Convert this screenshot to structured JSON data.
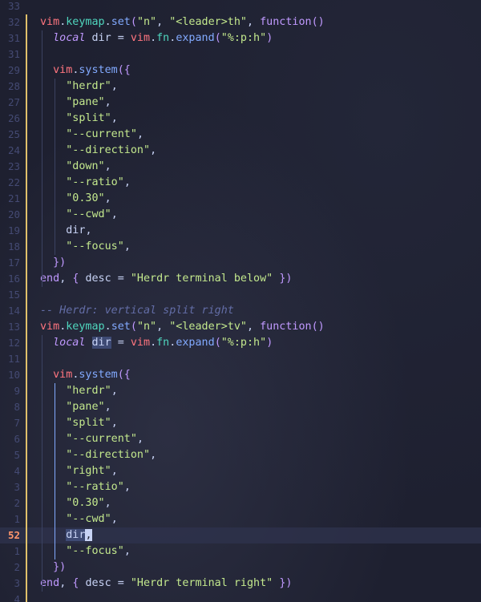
{
  "cursor_line_number": "52",
  "blocks": [
    {
      "numbers": {
        "header": "32",
        "local": "31",
        "blank": "31",
        "system": "29",
        "close_args": "17",
        "end": "16"
      },
      "keymap_mode": "\"n\"",
      "keymap_lhs": "\"<leader>th\"",
      "expand_arg": "\"%:p:h\"",
      "args": [
        "\"herdr\",",
        "\"pane\",",
        "\"split\",",
        "\"--current\",",
        "\"--direction\",",
        "\"down\",",
        "\"--ratio\",",
        "\"0.30\",",
        "\"--cwd\",",
        "dir,",
        "\"--focus\","
      ],
      "arg_numbers": [
        "28",
        "27",
        "26",
        "25",
        "24",
        "23",
        "22",
        "21",
        "20",
        "19",
        "18"
      ],
      "desc": "\"Herdr terminal below\""
    }
  ],
  "lines": [
    {
      "n": "33",
      "kind": "blank"
    },
    {
      "n": "32",
      "kind": "keymap",
      "mode": "\"n\"",
      "lhs": "\"<leader>th\""
    },
    {
      "n": "31",
      "kind": "local",
      "expand": "\"%:p:h\"",
      "hl": false
    },
    {
      "n": "31",
      "kind": "blank"
    },
    {
      "n": "29",
      "kind": "system"
    },
    {
      "n": "28",
      "kind": "arg",
      "text": "\"herdr\""
    },
    {
      "n": "27",
      "kind": "arg",
      "text": "\"pane\""
    },
    {
      "n": "26",
      "kind": "arg",
      "text": "\"split\""
    },
    {
      "n": "25",
      "kind": "arg",
      "text": "\"--current\""
    },
    {
      "n": "24",
      "kind": "arg",
      "text": "\"--direction\""
    },
    {
      "n": "23",
      "kind": "arg",
      "text": "\"down\""
    },
    {
      "n": "22",
      "kind": "arg",
      "text": "\"--ratio\""
    },
    {
      "n": "21",
      "kind": "arg",
      "text": "\"0.30\""
    },
    {
      "n": "20",
      "kind": "arg",
      "text": "\"--cwd\""
    },
    {
      "n": "19",
      "kind": "argid",
      "text": "dir"
    },
    {
      "n": "18",
      "kind": "arg",
      "text": "\"--focus\""
    },
    {
      "n": "17",
      "kind": "close"
    },
    {
      "n": "16",
      "kind": "end",
      "desc": "\"Herdr terminal below\""
    },
    {
      "n": "15",
      "kind": "blank"
    },
    {
      "n": "14",
      "kind": "comment",
      "text": "-- Herdr: vertical split right"
    },
    {
      "n": "13",
      "kind": "keymap",
      "mode": "\"n\"",
      "lhs": "\"<leader>tv\""
    },
    {
      "n": "12",
      "kind": "local",
      "expand": "\"%:p:h\"",
      "hl": true
    },
    {
      "n": "11",
      "kind": "blank"
    },
    {
      "n": "10",
      "kind": "system"
    },
    {
      "n": "9",
      "kind": "arg",
      "text": "\"herdr\""
    },
    {
      "n": "8",
      "kind": "arg",
      "text": "\"pane\""
    },
    {
      "n": "7",
      "kind": "arg",
      "text": "\"split\""
    },
    {
      "n": "6",
      "kind": "arg",
      "text": "\"--current\""
    },
    {
      "n": "5",
      "kind": "arg",
      "text": "\"--direction\""
    },
    {
      "n": "4",
      "kind": "arg",
      "text": "\"right\""
    },
    {
      "n": "3",
      "kind": "arg",
      "text": "\"--ratio\""
    },
    {
      "n": "2",
      "kind": "arg",
      "text": "\"0.30\""
    },
    {
      "n": "1",
      "kind": "arg",
      "text": "\"--cwd\""
    },
    {
      "n": "52",
      "kind": "cursorid",
      "text": "dir"
    },
    {
      "n": "1",
      "kind": "arg",
      "text": "\"--focus\""
    },
    {
      "n": "2",
      "kind": "close"
    },
    {
      "n": "3",
      "kind": "end",
      "desc": "\"Herdr terminal right\""
    },
    {
      "n": "4",
      "kind": "blank"
    }
  ],
  "tokens": {
    "vim": "vim",
    "keymap": "keymap",
    "set": "set",
    "function": "function",
    "local": "local",
    "dir": "dir",
    "eq": "=",
    "fn": "fn",
    "expand": "expand",
    "system": "system",
    "end": "end",
    "desc": "desc"
  },
  "colors": {
    "background": "#1e2030",
    "line_number": "#444a73",
    "cursor_line_number": "#ff966c",
    "git_sign": "#e0c06a",
    "keyword": "#c099ff",
    "vim_global": "#ff757f",
    "function": "#82aaff",
    "property": "#4fd6be",
    "string": "#c3e88d",
    "comment": "#636da6"
  }
}
